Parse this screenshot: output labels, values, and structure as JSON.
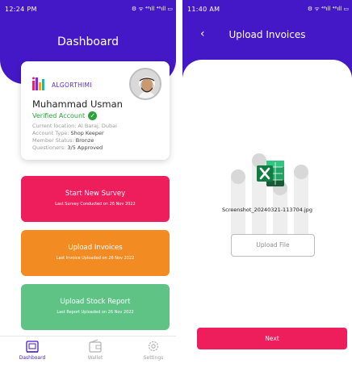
{
  "left": {
    "status_bar": {
      "time": "12:24 PM",
      "icons_text": "⚙ ᯤ ⁴⁶ıll ⁴⁶ıll ▭"
    },
    "header": {
      "title": "Dashboard"
    },
    "profile": {
      "brand": "ALGORTHIMI",
      "name": "Muhammad Usman",
      "verified_label": "Verified Account",
      "location_label": "Current location:",
      "location_value": "Al Baraj, Dubai",
      "account_type_label": "Account Type:",
      "account_type_value": "Shop Keeper",
      "member_status_label": "Member Status:",
      "member_status_value": "Bronze",
      "questioners_label": "Questioners:",
      "questioners_value": "3/5 Approved"
    },
    "actions": [
      {
        "title": "Start New Survey",
        "subtitle": "Last Survey Conducted on 26 Nov 2022",
        "color": "#ee1d5c"
      },
      {
        "title": "Upload Invoices",
        "subtitle": "Last Invoice Uploaded on 26 Nov 2022",
        "color": "#f38b23"
      },
      {
        "title": "Upload Stock Report",
        "subtitle": "Last Report Uploaded on 26 Nov 2022",
        "color": "#5fc386"
      }
    ],
    "nav": {
      "dashboard": "Dashboard",
      "wallet": "Wallet",
      "settings": "Settings"
    }
  },
  "right": {
    "status_bar": {
      "time": "11:40 AM",
      "icons_text": "⚙ ᯤ ⁴⁶ıll ⁴⁶ıll ▭"
    },
    "header": {
      "title": "Upload Invoices",
      "back_icon": "‹"
    },
    "file_name": "Screenshot_20240321-113704.jpg",
    "upload_file_label": "Upload File",
    "next_label": "Next"
  },
  "colors": {
    "brand_purple": "#4418c7",
    "pink": "#ee1d5c",
    "orange": "#f38b23",
    "green": "#5fc386",
    "verified": "#2aa33b",
    "excel_green": "#1f7244"
  },
  "icons": [
    "logo-icon",
    "avatar",
    "verified-check-icon",
    "dashboard-icon",
    "wallet-icon",
    "settings-icon",
    "back-arrow-icon",
    "excel-file-icon"
  ]
}
